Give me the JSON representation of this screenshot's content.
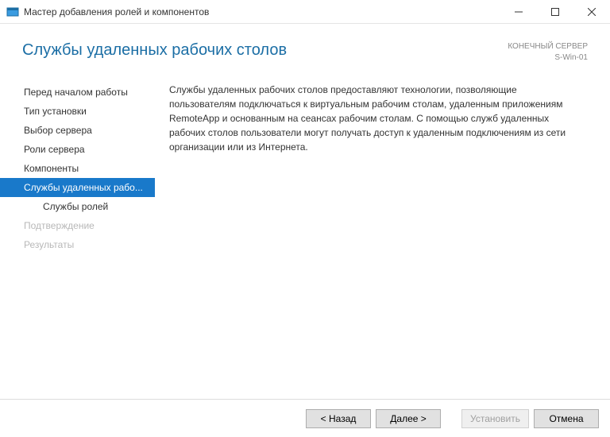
{
  "window": {
    "title": "Мастер добавления ролей и компонентов"
  },
  "header": {
    "page_title": "Службы удаленных рабочих столов",
    "dest_label": "КОНЕЧНЫЙ СЕРВЕР",
    "dest_value": "S-Win-01"
  },
  "sidebar": {
    "items": [
      {
        "label": "Перед началом работы",
        "state": "normal"
      },
      {
        "label": "Тип установки",
        "state": "normal"
      },
      {
        "label": "Выбор сервера",
        "state": "normal"
      },
      {
        "label": "Роли сервера",
        "state": "normal"
      },
      {
        "label": "Компоненты",
        "state": "normal"
      },
      {
        "label": "Службы удаленных рабо...",
        "state": "selected"
      },
      {
        "label": "Службы ролей",
        "state": "sub"
      },
      {
        "label": "Подтверждение",
        "state": "disabled"
      },
      {
        "label": "Результаты",
        "state": "disabled"
      }
    ]
  },
  "content": {
    "description": "Службы удаленных рабочих столов предоставляют технологии, позволяющие пользователям подключаться к виртуальным рабочим столам, удаленным приложениям RemoteApp и основанным на сеансах рабочим столам. С помощью служб удаленных рабочих столов пользователи могут получать доступ к удаленным подключениям из сети организации или из Интернета."
  },
  "footer": {
    "back": "< Назад",
    "next": "Далее >",
    "install": "Установить",
    "cancel": "Отмена"
  }
}
